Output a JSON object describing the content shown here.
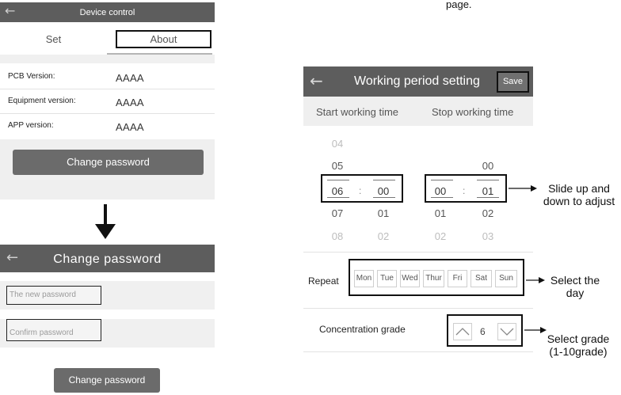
{
  "top_caption": "page.",
  "device_control": {
    "title": "Device control",
    "back_icon": "arrow-left-icon",
    "tabs": [
      "Set",
      "About"
    ],
    "rows": [
      {
        "label": "PCB Version:",
        "value": "AAAA"
      },
      {
        "label": "Equipment version:",
        "value": "AAAA"
      },
      {
        "label": "APP version:",
        "value": "AAAA"
      }
    ],
    "button": "Change password"
  },
  "change_password": {
    "title": "Change password",
    "back_icon": "arrow-left-icon",
    "new_password_placeholder": "The new password",
    "confirm_password_placeholder": "Confirm password",
    "button": "Change password"
  },
  "working_period": {
    "title": "Working period setting",
    "save": "Save",
    "start_label": "Start working time",
    "stop_label": "Stop working time",
    "start_hour": [
      "04",
      "05",
      "06",
      "07",
      "08"
    ],
    "start_minute": [
      "00",
      "01",
      "02"
    ],
    "stop_hour": [
      "00",
      "01",
      "02"
    ],
    "stop_minute": [
      "00",
      "01",
      "02",
      "03"
    ],
    "separator": ":",
    "repeat_label": "Repeat",
    "days": [
      "Mon",
      "Tue",
      "Wed",
      "Thur",
      "Fri",
      "Sat",
      "Sun"
    ],
    "concentration_label": "Concentration grade",
    "grade_value": "6",
    "up_icon": "chevron-up-icon",
    "down_icon": "chevron-down-icon"
  },
  "annotations": {
    "slide": [
      "Slide up and",
      "down to adjust"
    ],
    "day": [
      "Select the",
      "day"
    ],
    "grade": [
      "Select grade",
      "(1-10grade)"
    ]
  }
}
